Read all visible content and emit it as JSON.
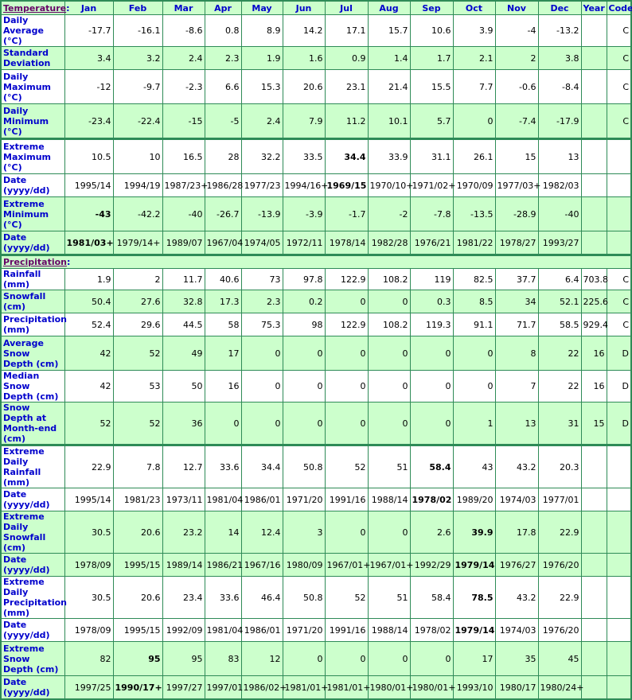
{
  "header": {
    "section_temperature": "Temperature",
    "colon": ":",
    "months": [
      "Jan",
      "Feb",
      "Mar",
      "Apr",
      "May",
      "Jun",
      "Jul",
      "Aug",
      "Sep",
      "Oct",
      "Nov",
      "Dec",
      "Year",
      "Code"
    ]
  },
  "temperature_rows": [
    {
      "label": "Daily Average (°C)",
      "values": [
        "-17.7",
        "-16.1",
        "-8.6",
        "0.8",
        "8.9",
        "14.2",
        "17.1",
        "15.7",
        "10.6",
        "3.9",
        "-4",
        "-13.2",
        "",
        "C"
      ],
      "bold": []
    },
    {
      "label": "Standard Deviation",
      "values": [
        "3.4",
        "3.2",
        "2.4",
        "2.3",
        "1.9",
        "1.6",
        "0.9",
        "1.4",
        "1.7",
        "2.1",
        "2",
        "3.8",
        "",
        "C"
      ],
      "bold": []
    },
    {
      "label": "Daily Maximum (°C)",
      "values": [
        "-12",
        "-9.7",
        "-2.3",
        "6.6",
        "15.3",
        "20.6",
        "23.1",
        "21.4",
        "15.5",
        "7.7",
        "-0.6",
        "-8.4",
        "",
        "C"
      ],
      "bold": []
    },
    {
      "label": "Daily Minimum (°C)",
      "values": [
        "-23.4",
        "-22.4",
        "-15",
        "-5",
        "2.4",
        "7.9",
        "11.2",
        "10.1",
        "5.7",
        "0",
        "-7.4",
        "-17.9",
        "",
        "C"
      ],
      "bold": []
    },
    {
      "label": "Extreme Maximum (°C)",
      "values": [
        "10.5",
        "10",
        "16.5",
        "28",
        "32.2",
        "33.5",
        "34.4",
        "33.9",
        "31.1",
        "26.1",
        "15",
        "13",
        "",
        ""
      ],
      "bold": [
        6
      ]
    },
    {
      "label": "Date (yyyy/dd)",
      "values": [
        "1995/14",
        "1994/19",
        "1987/23+",
        "1986/28",
        "1977/23",
        "1994/16+",
        "1969/15",
        "1970/10+",
        "1971/02+",
        "1970/09",
        "1977/03+",
        "1982/03",
        "",
        ""
      ],
      "bold": [
        6
      ]
    },
    {
      "label": "Extreme Minimum (°C)",
      "values": [
        "-43",
        "-42.2",
        "-40",
        "-26.7",
        "-13.9",
        "-3.9",
        "-1.7",
        "-2",
        "-7.8",
        "-13.5",
        "-28.9",
        "-40",
        "",
        ""
      ],
      "bold": [
        0
      ]
    },
    {
      "label": "Date (yyyy/dd)",
      "values": [
        "1981/03+",
        "1979/14+",
        "1989/07",
        "1967/04",
        "1974/05",
        "1972/11",
        "1978/14",
        "1982/28",
        "1976/21",
        "1981/22",
        "1978/27",
        "1993/27",
        "",
        ""
      ],
      "bold": [
        0
      ]
    }
  ],
  "precip_header": {
    "section_precipitation": "Precipitation",
    "colon": ":"
  },
  "precip_rows": [
    {
      "label": "Rainfall (mm)",
      "values": [
        "1.9",
        "2",
        "11.7",
        "40.6",
        "73",
        "97.8",
        "122.9",
        "108.2",
        "119",
        "82.5",
        "37.7",
        "6.4",
        "703.8",
        "C"
      ],
      "bold": []
    },
    {
      "label": "Snowfall (cm)",
      "values": [
        "50.4",
        "27.6",
        "32.8",
        "17.3",
        "2.3",
        "0.2",
        "0",
        "0",
        "0.3",
        "8.5",
        "34",
        "52.1",
        "225.6",
        "C"
      ],
      "bold": []
    },
    {
      "label": "Precipitation (mm)",
      "values": [
        "52.4",
        "29.6",
        "44.5",
        "58",
        "75.3",
        "98",
        "122.9",
        "108.2",
        "119.3",
        "91.1",
        "71.7",
        "58.5",
        "929.4",
        "C"
      ],
      "bold": []
    },
    {
      "label": "Average Snow Depth (cm)",
      "values": [
        "42",
        "52",
        "49",
        "17",
        "0",
        "0",
        "0",
        "0",
        "0",
        "0",
        "8",
        "22",
        "16",
        "D"
      ],
      "bold": []
    },
    {
      "label": "Median Snow Depth (cm)",
      "values": [
        "42",
        "53",
        "50",
        "16",
        "0",
        "0",
        "0",
        "0",
        "0",
        "0",
        "7",
        "22",
        "16",
        "D"
      ],
      "bold": []
    },
    {
      "label": "Snow Depth at Month-end (cm)",
      "values": [
        "52",
        "52",
        "36",
        "0",
        "0",
        "0",
        "0",
        "0",
        "0",
        "1",
        "13",
        "31",
        "15",
        "D"
      ],
      "bold": []
    }
  ],
  "extreme_rows": [
    {
      "label": "Extreme Daily Rainfall (mm)",
      "values": [
        "22.9",
        "7.8",
        "12.7",
        "33.6",
        "34.4",
        "50.8",
        "52",
        "51",
        "58.4",
        "43",
        "43.2",
        "20.3",
        "",
        ""
      ],
      "bold": [
        8
      ]
    },
    {
      "label": "Date (yyyy/dd)",
      "values": [
        "1995/14",
        "1981/23",
        "1973/11",
        "1981/04",
        "1986/01",
        "1971/20",
        "1991/16",
        "1988/14",
        "1978/02",
        "1989/20",
        "1974/03",
        "1977/01",
        "",
        ""
      ],
      "bold": [
        8
      ]
    },
    {
      "label": "Extreme Daily Snowfall (cm)",
      "values": [
        "30.5",
        "20.6",
        "23.2",
        "14",
        "12.4",
        "3",
        "0",
        "0",
        "2.6",
        "39.9",
        "17.8",
        "22.9",
        "",
        ""
      ],
      "bold": [
        9
      ]
    },
    {
      "label": "Date (yyyy/dd)",
      "values": [
        "1978/09",
        "1995/15",
        "1989/14",
        "1986/21",
        "1967/16",
        "1980/09",
        "1967/01+",
        "1967/01+",
        "1992/29",
        "1979/14",
        "1976/27",
        "1976/20",
        "",
        ""
      ],
      "bold": [
        9
      ]
    },
    {
      "label": "Extreme Daily Precipitation (mm)",
      "values": [
        "30.5",
        "20.6",
        "23.4",
        "33.6",
        "46.4",
        "50.8",
        "52",
        "51",
        "58.4",
        "78.5",
        "43.2",
        "22.9",
        "",
        ""
      ],
      "bold": [
        9
      ]
    },
    {
      "label": "Date (yyyy/dd)",
      "values": [
        "1978/09",
        "1995/15",
        "1992/09",
        "1981/04",
        "1986/01",
        "1971/20",
        "1991/16",
        "1988/14",
        "1978/02",
        "1979/14",
        "1974/03",
        "1976/20",
        "",
        ""
      ],
      "bold": [
        9
      ]
    },
    {
      "label": "Extreme Snow Depth (cm)",
      "values": [
        "82",
        "95",
        "95",
        "83",
        "12",
        "0",
        "0",
        "0",
        "0",
        "17",
        "35",
        "45",
        "",
        ""
      ],
      "bold": [
        1
      ]
    },
    {
      "label": "Date (yyyy/dd)",
      "values": [
        "1997/25",
        "1990/17+",
        "1997/27",
        "1997/01",
        "1986/02+",
        "1981/01+",
        "1981/01+",
        "1980/01+",
        "1980/01+",
        "1993/10",
        "1980/17",
        "1980/24+",
        "",
        ""
      ],
      "bold": [
        1
      ]
    }
  ]
}
